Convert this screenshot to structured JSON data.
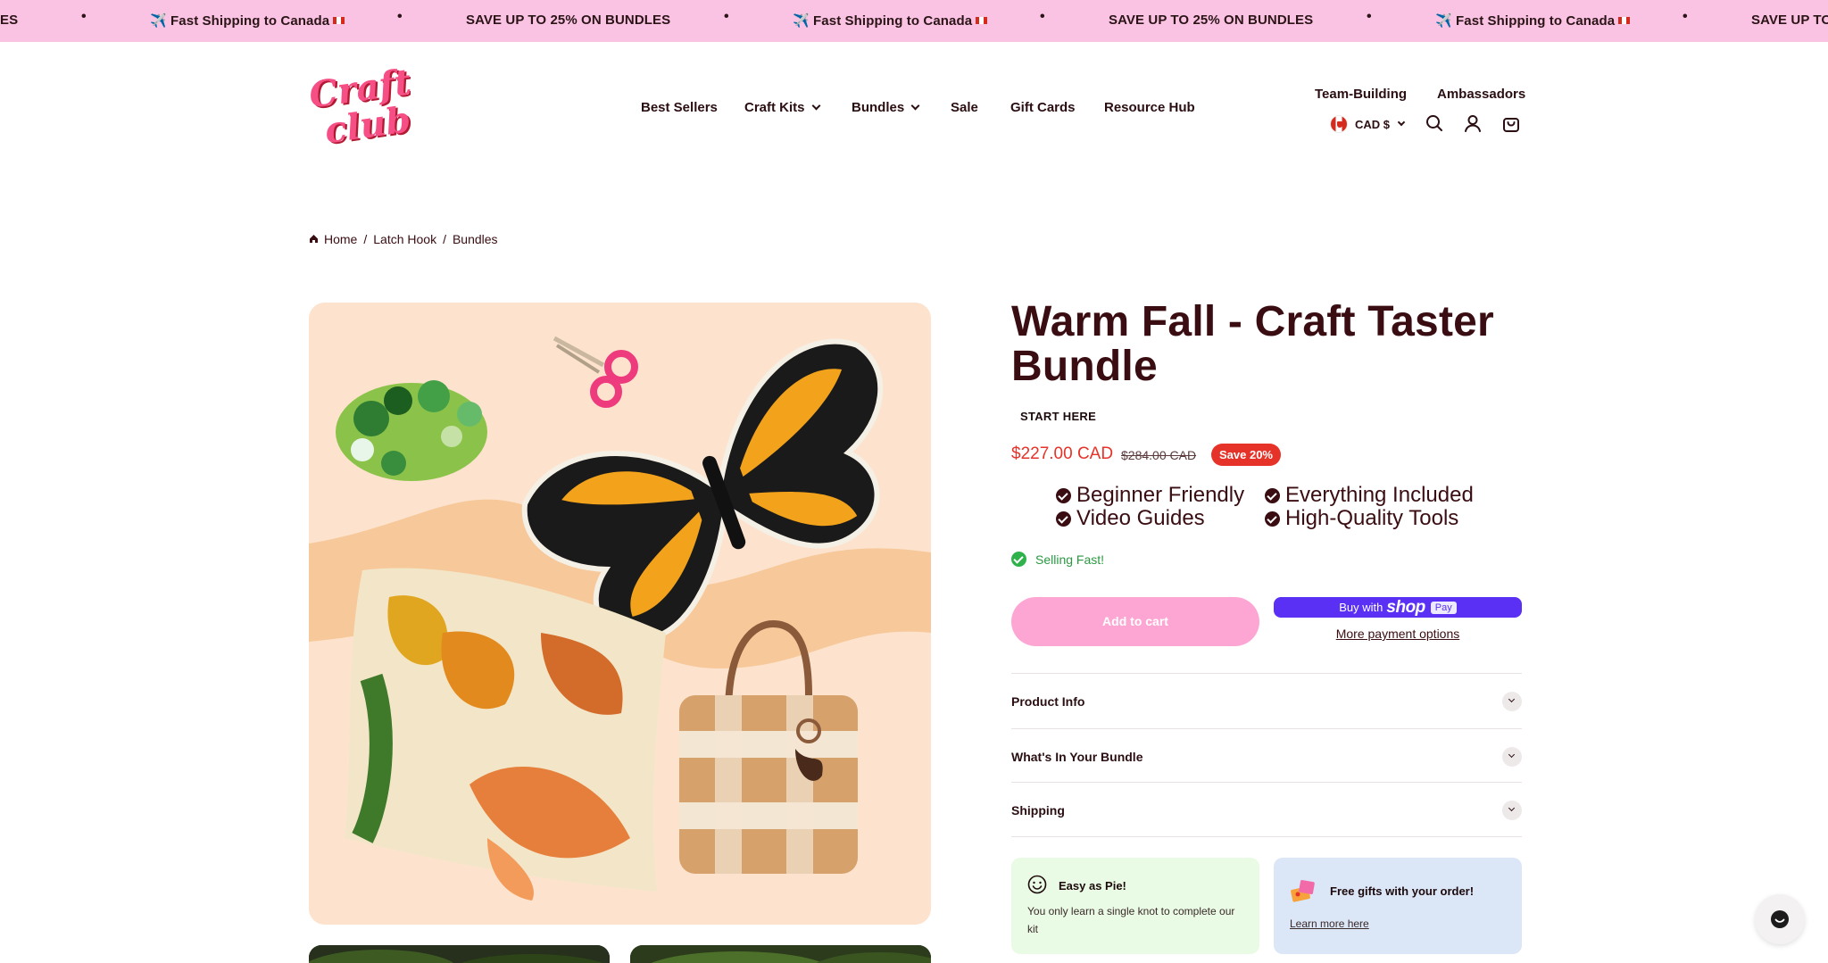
{
  "announcement": {
    "items": [
      "✈️ Fast Shipping to Canada",
      "SAVE UP TO 25% ON BUNDLES",
      "✈️ Fast Shipping to Canada",
      "SAVE UP TO 25% ON BUNDLES",
      "✈️ Fast Shipping to Canada",
      "SAVE UP TO 25% ON BUNDLES"
    ],
    "edge_left": "ES"
  },
  "header": {
    "logo_text": "Craft Club",
    "nav": [
      {
        "label": "Best Sellers"
      },
      {
        "label": "Craft Kits"
      },
      {
        "label": "Bundles"
      },
      {
        "label": "Sale"
      },
      {
        "label": "Gift Cards"
      },
      {
        "label": "Resource Hub"
      }
    ],
    "util_links": [
      "Team-Building",
      "Ambassadors"
    ],
    "currency": "CAD $",
    "icons": [
      "search-icon",
      "account-icon",
      "cart-icon"
    ]
  },
  "breadcrumb": [
    "Home",
    "Latch Hook",
    "Bundles"
  ],
  "product": {
    "title": "Warm Fall - Craft Taster Bundle",
    "tag": "START HERE",
    "price": "$227.00 CAD",
    "compare_price": "$284.00 CAD",
    "save_badge": "Save 20%",
    "features": [
      "Beginner Friendly",
      "Everything Included",
      "Video Guides",
      "High-Quality Tools"
    ],
    "stock_status": "Selling Fast!",
    "add_to_cart": "Add to cart",
    "shop_pay": {
      "prefix": "Buy with",
      "brand": "shop",
      "pay": "Pay"
    },
    "more_payment": "More payment options",
    "accordions": [
      "Product Info",
      "What's In Your Bundle",
      "Shipping"
    ],
    "cards": [
      {
        "title": "Easy as Pie!",
        "text": "You only learn a single knot to complete our kit",
        "icon": "smiley-icon"
      },
      {
        "title": "Free gifts with your order!",
        "link": "Learn more here",
        "icon": "gift-icon"
      }
    ]
  },
  "colors": {
    "announcement_bg": "#fbc3e3",
    "brand_text": "#3a0d12",
    "sale_red": "#e5332a",
    "cart_pink": "#fda6d4",
    "shop_pay": "#5a31f4",
    "stock_green": "#2fb24c"
  }
}
